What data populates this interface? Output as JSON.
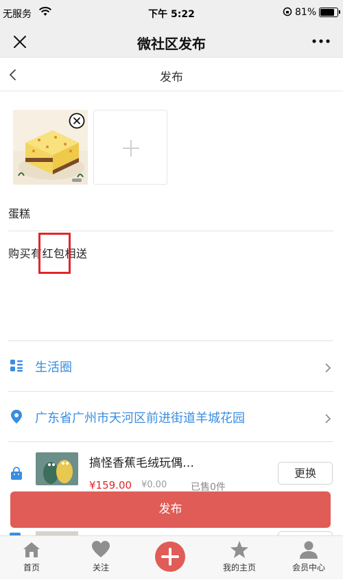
{
  "status_bar": {
    "carrier": "无服务",
    "time": "下午 5:22",
    "battery": "81%"
  },
  "wechat_nav": {
    "title": "微社区发布"
  },
  "page": {
    "title": "发布"
  },
  "post": {
    "title": "蛋糕",
    "description": "购买有红包相送"
  },
  "category": {
    "label": "生活圈"
  },
  "location": {
    "label": "广东省广州市天河区前进街道羊城花园"
  },
  "product": {
    "title": "搞怪香蕉毛绒玩偶…",
    "price": "¥159.00",
    "original_price": "¥0.00",
    "stock": "已售0件",
    "change_label": "更换"
  },
  "publish_label": "发布",
  "tabbar": {
    "home": "首页",
    "follow": "关注",
    "my_page": "我的主页",
    "member": "会员中心"
  },
  "colors": {
    "accent": "#e05c57",
    "link": "#3a8de0",
    "highlight": "#e0262c"
  }
}
